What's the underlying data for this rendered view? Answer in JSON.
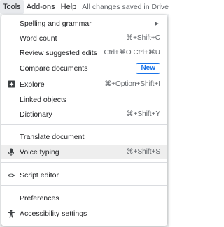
{
  "menubar": {
    "items": [
      "Tools",
      "Add-ons",
      "Help"
    ],
    "saved_status": "All changes saved in Drive"
  },
  "tools_menu": {
    "items": [
      {
        "label": "Spelling and grammar",
        "shortcut": "",
        "icon": "",
        "submenu": true
      },
      {
        "label": "Word count",
        "shortcut": "⌘+Shift+C",
        "icon": ""
      },
      {
        "label": "Review suggested edits",
        "shortcut": "Ctrl+⌘O Ctrl+⌘U",
        "icon": ""
      },
      {
        "label": "Compare documents",
        "shortcut": "",
        "icon": "",
        "badge": "New"
      },
      {
        "label": "Explore",
        "shortcut": "⌘+Option+Shift+I",
        "icon": "explore-icon"
      },
      {
        "label": "Linked objects",
        "shortcut": "",
        "icon": ""
      },
      {
        "label": "Dictionary",
        "shortcut": "⌘+Shift+Y",
        "icon": ""
      },
      {
        "label": "Translate document",
        "shortcut": "",
        "icon": ""
      },
      {
        "label": "Voice typing",
        "shortcut": "⌘+Shift+S",
        "icon": "microphone-icon"
      },
      {
        "label": "Script editor",
        "shortcut": "",
        "icon": "code-icon"
      },
      {
        "label": "Preferences",
        "shortcut": "",
        "icon": ""
      },
      {
        "label": "Accessibility settings",
        "shortcut": "",
        "icon": "accessibility-icon"
      }
    ]
  }
}
